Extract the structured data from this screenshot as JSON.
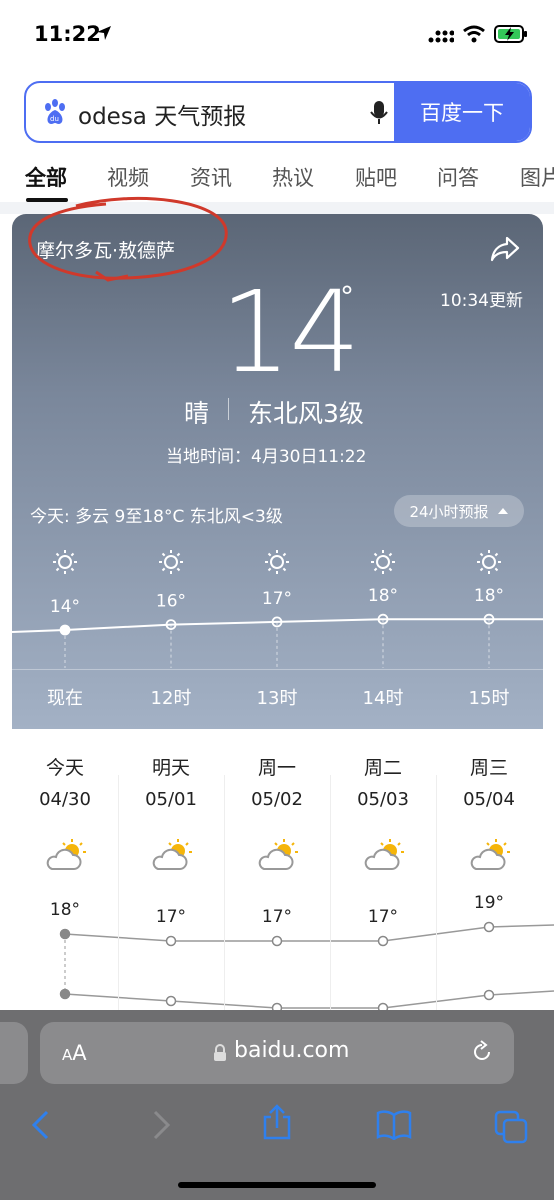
{
  "status_bar": {
    "time": "11:22"
  },
  "search": {
    "query": "odesa 天气预报",
    "button_label": "百度一下"
  },
  "tabs": [
    {
      "label": "全部"
    },
    {
      "label": "视频"
    },
    {
      "label": "资讯"
    },
    {
      "label": "热议"
    },
    {
      "label": "贴吧"
    },
    {
      "label": "问答"
    },
    {
      "label": "图片"
    }
  ],
  "weather": {
    "location": "摩尔多瓦·敖德萨",
    "updated": "10:34更新",
    "temperature": "14",
    "degree_symbol": "°",
    "condition": "晴",
    "wind": "东北风3级",
    "local_time": "当地时间：4月30日11:22",
    "today_summary": "今天: 多云  9至18°C  东北风<3级",
    "hourly_button": "24小时预报",
    "hourly": [
      {
        "time": "现在",
        "temp": "14°",
        "value": 14
      },
      {
        "time": "12时",
        "temp": "16°",
        "value": 16
      },
      {
        "time": "13时",
        "temp": "17°",
        "value": 17
      },
      {
        "time": "14时",
        "temp": "18°",
        "value": 18
      },
      {
        "time": "15时",
        "temp": "18°",
        "value": 18
      }
    ]
  },
  "daily": [
    {
      "name": "今天",
      "date": "04/30",
      "high": "18°",
      "high_value": 18
    },
    {
      "name": "明天",
      "date": "05/01",
      "high": "17°",
      "high_value": 17
    },
    {
      "name": "周一",
      "date": "05/02",
      "high": "17°",
      "high_value": 17
    },
    {
      "name": "周二",
      "date": "05/03",
      "high": "17°",
      "high_value": 17
    },
    {
      "name": "周三",
      "date": "05/04",
      "high": "19°",
      "high_value": 19
    }
  ],
  "browser": {
    "aa_label": "AA",
    "url": "baidu.com"
  },
  "colors": {
    "accent": "#4e6ef2",
    "annotation": "#d0392b"
  }
}
